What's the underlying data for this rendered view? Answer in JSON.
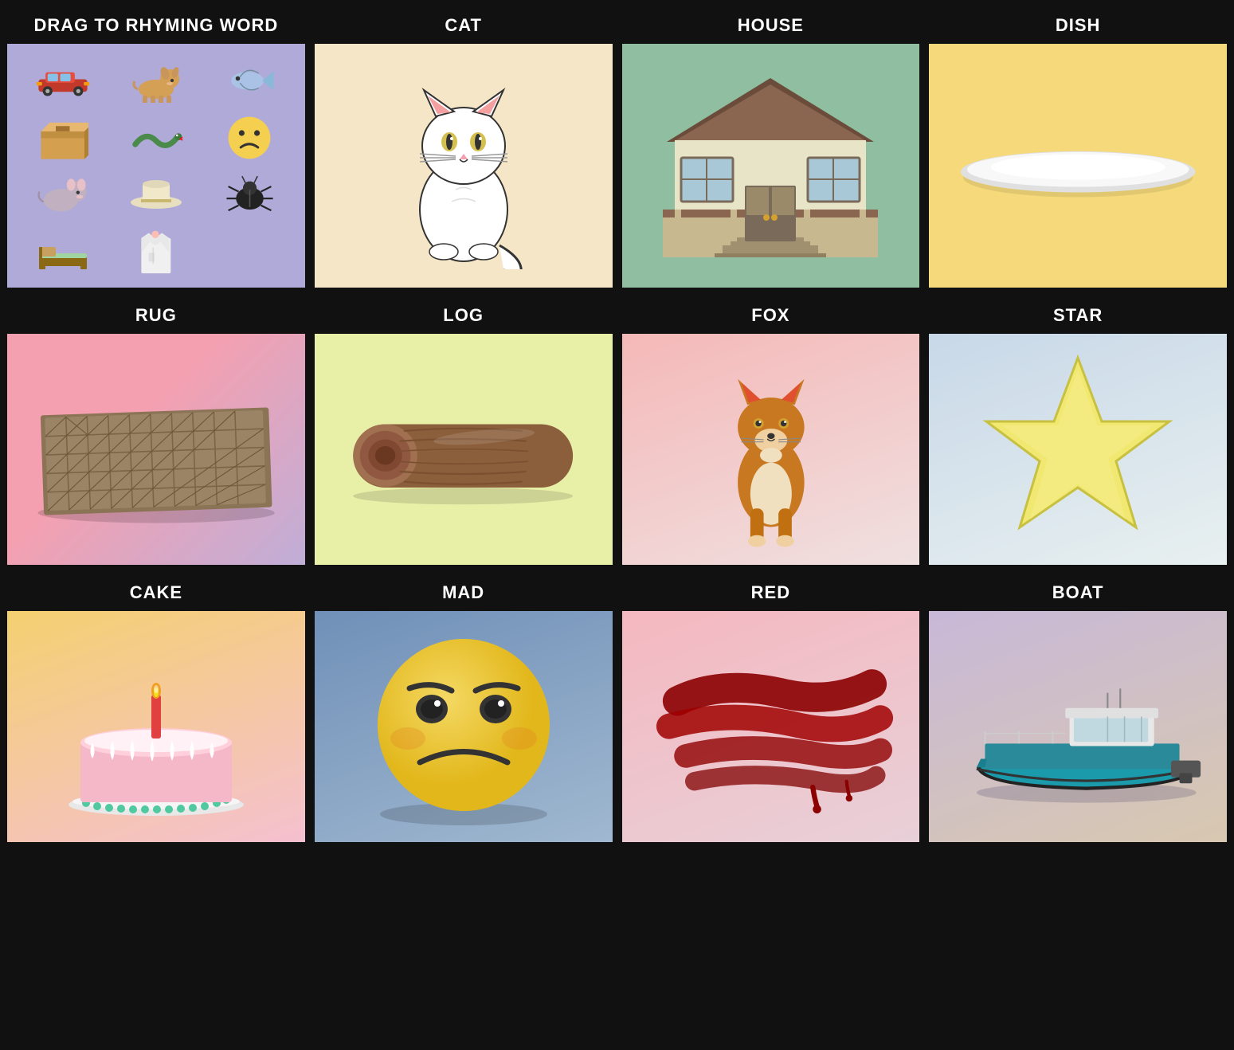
{
  "cells": [
    {
      "id": "drag",
      "header": "DRAG TO RHYMING WORD",
      "bg": "drag-bg"
    },
    {
      "id": "cat",
      "header": "CAT",
      "bg": "cat-bg"
    },
    {
      "id": "house",
      "header": "HOUSE",
      "bg": "house-bg"
    },
    {
      "id": "dish",
      "header": "DISH",
      "bg": "dish-bg"
    },
    {
      "id": "rug",
      "header": "RUG",
      "bg": "rug-bg"
    },
    {
      "id": "log",
      "header": "LOG",
      "bg": "log-bg"
    },
    {
      "id": "fox",
      "header": "FOX",
      "bg": "fox-bg"
    },
    {
      "id": "star",
      "header": "STAR",
      "bg": "star-bg"
    },
    {
      "id": "cake",
      "header": "CAKE",
      "bg": "cake-bg"
    },
    {
      "id": "mad",
      "header": "MAD",
      "bg": "mad-bg"
    },
    {
      "id": "red",
      "header": "RED",
      "bg": "red-bg"
    },
    {
      "id": "boat",
      "header": "BOAT",
      "bg": "boat-bg"
    }
  ]
}
